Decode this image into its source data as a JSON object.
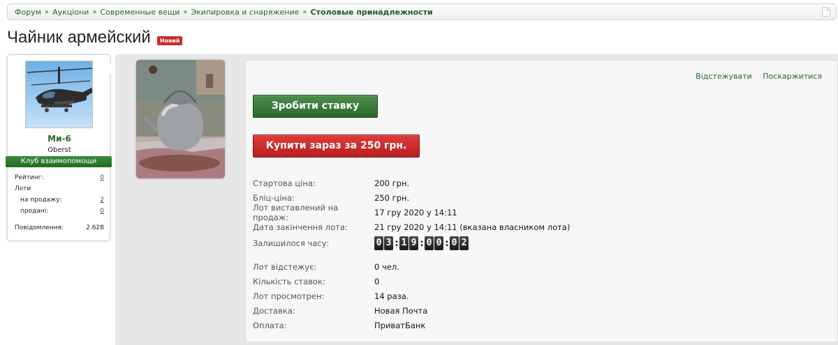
{
  "breadcrumb": {
    "items": [
      "Форум",
      "Аукціони",
      "Современные вещи",
      "Экипировка и снаряжение"
    ],
    "current": "Столовые принадлежности",
    "separator": "»"
  },
  "title": "Чайник армейский",
  "badge": "Новий",
  "user": {
    "name": "Ми-6",
    "rank": "Oberst",
    "club": "Клуб взаимопомощи",
    "stats": {
      "rating_label": "Рейтинг:",
      "rating_value": "0",
      "lots_label": "Лоти",
      "for_sale_label": "на продажу:",
      "for_sale_value": "2",
      "sold_label": "продані:",
      "sold_value": "0",
      "messages_label": "Повідомлення:",
      "messages_value": "2.628"
    }
  },
  "actions": {
    "watch": "Відстежувати",
    "report": "Поскаржитися",
    "bid": "Зробити ставку",
    "buy_now": "Купити зараз за 250 грн."
  },
  "lot": {
    "start_price_label": "Стартова ціна:",
    "start_price": "200 грн.",
    "blitz_price_label": "Бліц-ціна:",
    "blitz_price": "250 грн.",
    "listed_label": "Лот виставлений на продаж:",
    "listed": "17 гру 2020 у 14:11",
    "end_label": "Дата закінчення лота:",
    "end": "21 гру 2020 у 14:11 (вказана власником лота)",
    "remaining_label": "Залишилося часу:",
    "timer": {
      "d1": "0",
      "d2": "3",
      "h1": "1",
      "h2": "9",
      "m1": "0",
      "m2": "0",
      "s1": "0",
      "s2": "2"
    },
    "watchers_label": "Лот відстежує:",
    "watchers": "0 чел.",
    "bids_label": "Кількість ставок:",
    "bids": "0",
    "views_label": "Лот просмотрен:",
    "views": "14 раза.",
    "delivery_label": "Доставка:",
    "delivery": "Новая Почта",
    "payment_label": "Оплата:",
    "payment": "ПриватБанк"
  },
  "colors": {
    "link_green": "#276a2d",
    "bid_green": "#2a6a2a",
    "buy_red": "#c92a2a",
    "badge_red": "#c92a2a"
  }
}
